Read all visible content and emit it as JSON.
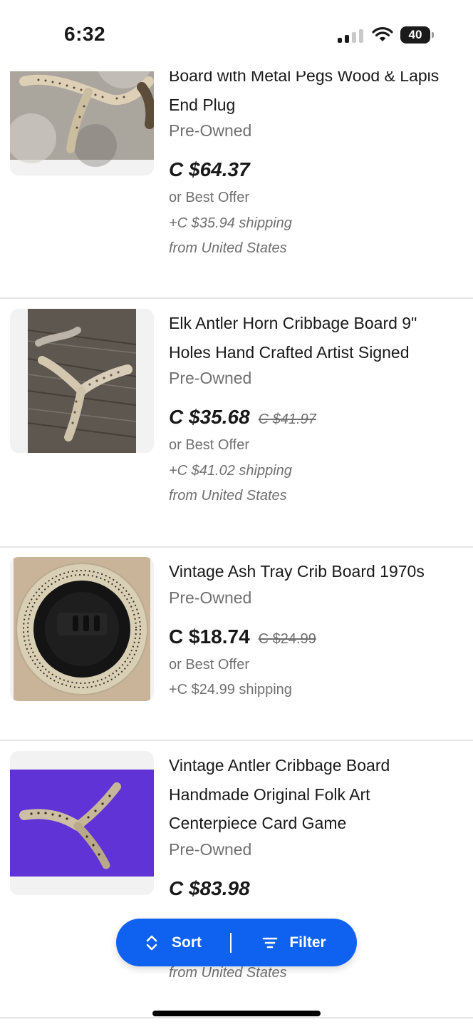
{
  "status_bar": {
    "time": "6:32",
    "battery": "40",
    "icons": [
      "signal-icon",
      "wifi-icon",
      "battery-icon"
    ]
  },
  "listings": [
    {
      "title_lines": [
        "Board with Metal Pegs Wood & Lapis",
        "End Plug"
      ],
      "condition": "Pre-Owned",
      "price": "C $64.37",
      "was_price": "",
      "best_offer": "or Best Offer",
      "shipping": "+C $35.94 shipping",
      "location": "from United States"
    },
    {
      "title_lines": [
        "Elk Antler Horn Cribbage Board 9\"",
        "Holes Hand Crafted Artist Signed"
      ],
      "condition": "Pre-Owned",
      "price": "C $35.68",
      "was_price": "C $41.97",
      "best_offer": "or Best Offer",
      "shipping": "+C $41.02 shipping",
      "location": "from United States"
    },
    {
      "title_lines": [
        "Vintage Ash Tray Crib Board 1970s"
      ],
      "condition": "Pre-Owned",
      "price": "C $18.74",
      "was_price": "C $24.99",
      "best_offer": "or Best Offer",
      "shipping": "+C $24.99 shipping",
      "location": ""
    },
    {
      "title_lines": [
        "Vintage Antler Cribbage Board",
        "Handmade Original Folk Art",
        "Centerpiece Card Game"
      ],
      "condition": "Pre-Owned",
      "price": "C $83.98",
      "was_price": "",
      "best_offer": "",
      "shipping": "",
      "location": "from United States"
    }
  ],
  "toolbar": {
    "sort_label": "Sort",
    "filter_label": "Filter"
  },
  "colors": {
    "accent": "#0f61f0",
    "text": "#191919",
    "muted": "#707070"
  }
}
